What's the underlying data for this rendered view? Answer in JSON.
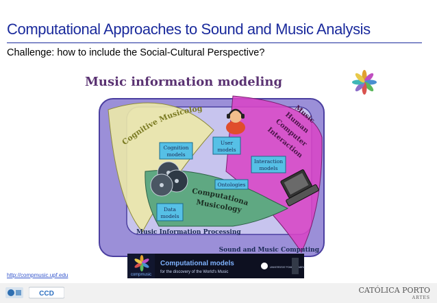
{
  "slide": {
    "title": "Computational Approaches to Sound and Music Analysis",
    "challenge": "Challenge: how to include the Social-Cultural Perspective?",
    "subheading": "Music information modeling",
    "url": "http://compmusic.upf.edu"
  },
  "diagram": {
    "arc_cognitive": "Cognitive Musicology",
    "arc_hci": [
      "Music",
      "Human",
      "Computer",
      "Interaction"
    ],
    "computational": [
      "Computational",
      "Musicology"
    ],
    "mip": "Music Information Processing",
    "smc": "Sound and Music Computing",
    "boxes": {
      "cognition": [
        "Cognition",
        "models"
      ],
      "user": [
        "User",
        "models"
      ],
      "interaction": [
        "Interaction",
        "models"
      ],
      "ontologies": "Ontologies",
      "data": [
        "Data",
        "models"
      ]
    }
  },
  "banner": {
    "brand": "compmusic",
    "headline": "Computational models",
    "tagline": "for the discovery of the World's Music",
    "partner": "UNIVERSITAT POMPEU FABRA"
  },
  "footer": {
    "institution": "CATÓLICA PORTO",
    "sub": "ARTES",
    "logo2_text": "CCD"
  },
  "colors": {
    "title": "#1a2a9c",
    "outer_box": "#9b8fd8",
    "inner_box": "#c7c4ee",
    "cognitive_area": "#ece9a8",
    "hci_area": "#d845c6",
    "computational_area": "#5fa882",
    "model_box": "#56c0e6"
  }
}
